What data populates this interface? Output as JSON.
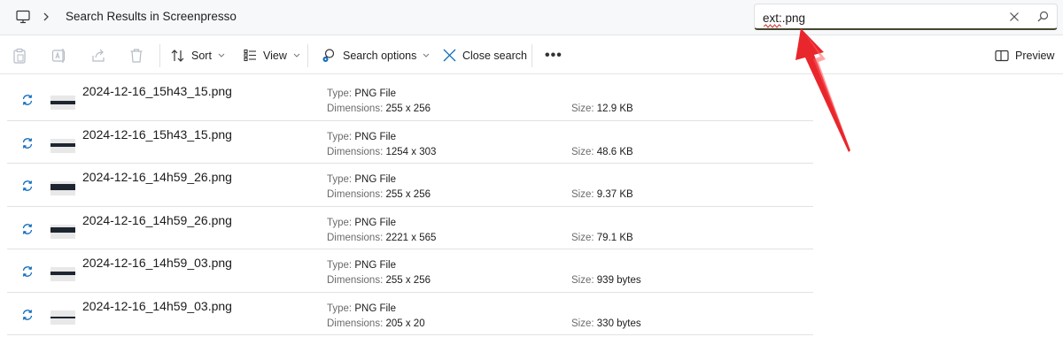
{
  "address": {
    "crumb": "Search Results in Screenpresso",
    "search_value": "ext:.png"
  },
  "toolbar": {
    "sort_label": "Sort",
    "view_label": "View",
    "search_options_label": "Search options",
    "close_search_label": "Close search",
    "more_label": "•••",
    "preview_label": "Preview"
  },
  "labels": {
    "type": "Type:",
    "dimensions": "Dimensions:",
    "size": "Size:"
  },
  "files": [
    {
      "name": "2024-12-16_15h43_15.png",
      "type": "PNG File",
      "dimensions": "255 x 256",
      "size": "12.9 KB"
    },
    {
      "name": "2024-12-16_15h43_15.png",
      "type": "PNG File",
      "dimensions": "1254 x 303",
      "size": "48.6 KB"
    },
    {
      "name": "2024-12-16_14h59_26.png",
      "type": "PNG File",
      "dimensions": "255 x 256",
      "size": "9.37 KB"
    },
    {
      "name": "2024-12-16_14h59_26.png",
      "type": "PNG File",
      "dimensions": "2221 x 565",
      "size": "79.1 KB"
    },
    {
      "name": "2024-12-16_14h59_03.png",
      "type": "PNG File",
      "dimensions": "255 x 256",
      "size": "939 bytes"
    },
    {
      "name": "2024-12-16_14h59_03.png",
      "type": "PNG File",
      "dimensions": "205 x 20",
      "size": "330 bytes"
    }
  ],
  "colors": {
    "accent": "#0f6cbd",
    "annotation_arrow": "#e8262b"
  }
}
